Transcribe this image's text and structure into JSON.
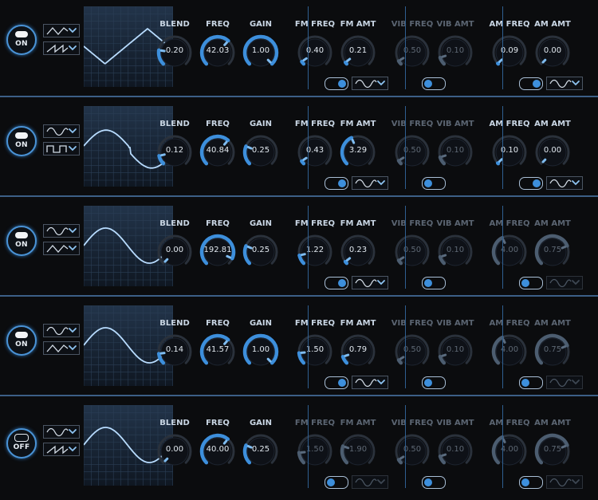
{
  "colors": {
    "accent": "#3d8fdc",
    "background": "#0b0c0e",
    "divider": "#3c5f86"
  },
  "labels": {
    "blend": "BLEND",
    "freq": "FREQ",
    "gain": "GAIN",
    "fm_freq": "FM FREQ",
    "fm_amt": "FM AMT",
    "vib_freq": "VIB FREQ",
    "vib_amt": "VIB AMT",
    "am_freq": "AM FREQ",
    "am_amt": "AM AMT"
  },
  "oscillators": [
    {
      "power": "ON",
      "wave1": "triangle",
      "wave2": "saw",
      "preview": "triangle",
      "blend": "0.20",
      "freq": "42.03",
      "gain": "1.00",
      "fm_freq": "0.40",
      "fm_amt": "0.21",
      "vib_freq": "0.50",
      "vib_amt": "0.10",
      "am_freq": "0.09",
      "am_amt": "0.00",
      "fm_enabled": true,
      "vib_enabled": false,
      "am_enabled": true,
      "fm_wave": "sine",
      "am_wave": "sine"
    },
    {
      "power": "ON",
      "wave1": "sine",
      "wave2": "square",
      "preview": "sine-square",
      "blend": "0.12",
      "freq": "40.84",
      "gain": "0.25",
      "fm_freq": "0.43",
      "fm_amt": "3.29",
      "vib_freq": "0.50",
      "vib_amt": "0.10",
      "am_freq": "0.10",
      "am_amt": "0.00",
      "fm_enabled": true,
      "vib_enabled": false,
      "am_enabled": true,
      "fm_wave": "sine",
      "am_wave": "sine"
    },
    {
      "power": "ON",
      "wave1": "sine",
      "wave2": "triangle",
      "preview": "sine",
      "blend": "0.00",
      "freq": "192.81",
      "gain": "0.25",
      "fm_freq": "1.22",
      "fm_amt": "0.23",
      "vib_freq": "0.50",
      "vib_amt": "0.10",
      "am_freq": "4.00",
      "am_amt": "0.75",
      "fm_enabled": true,
      "vib_enabled": false,
      "am_enabled": false,
      "fm_wave": "sine",
      "am_wave": "sine"
    },
    {
      "power": "ON",
      "wave1": "sine",
      "wave2": "triangle",
      "preview": "sine",
      "blend": "0.14",
      "freq": "41.57",
      "gain": "1.00",
      "fm_freq": "1.50",
      "fm_amt": "0.79",
      "vib_freq": "0.50",
      "vib_amt": "0.10",
      "am_freq": "4.00",
      "am_amt": "0.75",
      "fm_enabled": true,
      "vib_enabled": false,
      "am_enabled": false,
      "fm_wave": "sine",
      "am_wave": "sine"
    },
    {
      "power": "OFF",
      "wave1": "sine",
      "wave2": "saw",
      "preview": "sine",
      "blend": "0.00",
      "freq": "40.00",
      "gain": "0.25",
      "fm_freq": "1.50",
      "fm_amt": "1.90",
      "vib_freq": "0.50",
      "vib_amt": "0.10",
      "am_freq": "4.00",
      "am_amt": "0.75",
      "fm_enabled": false,
      "vib_enabled": false,
      "am_enabled": false,
      "fm_wave": "sine",
      "am_wave": "sine"
    }
  ]
}
